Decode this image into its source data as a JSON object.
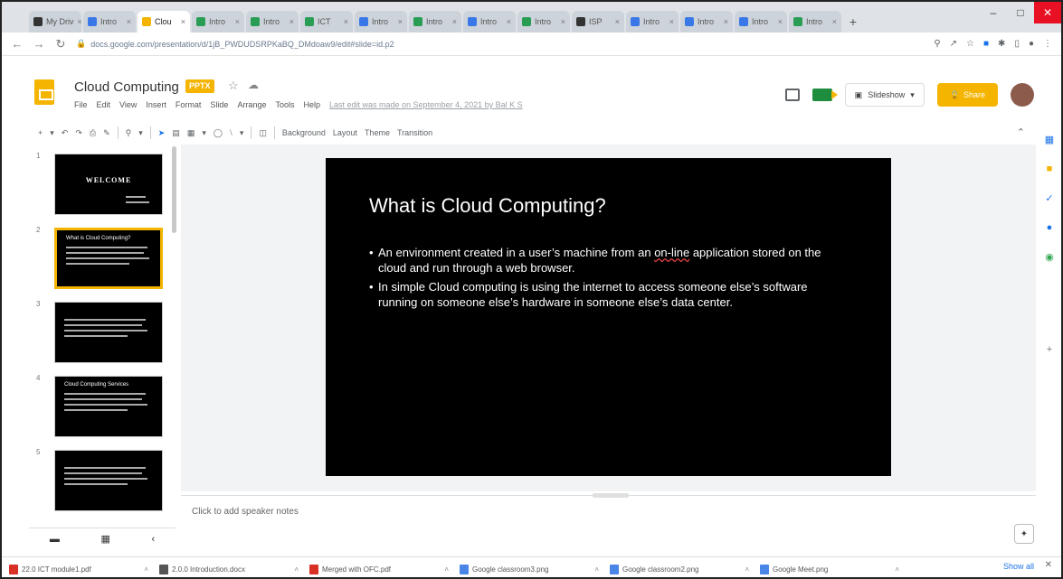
{
  "browser": {
    "tabs": [
      {
        "label": "My Driv",
        "icon": "drive-icon",
        "color": "dark",
        "active": false
      },
      {
        "label": "Intro",
        "icon": "slides-icon",
        "color": "blue",
        "active": false
      },
      {
        "label": "Clou",
        "icon": "slides-icon",
        "color": "yellow",
        "active": true
      },
      {
        "label": "Intro",
        "icon": "classroom-icon",
        "color": "",
        "active": false
      },
      {
        "label": "Intro",
        "icon": "classroom-icon",
        "color": "",
        "active": false
      },
      {
        "label": "ICT",
        "icon": "classroom-icon",
        "color": "",
        "active": false
      },
      {
        "label": "Intro",
        "icon": "google-icon",
        "color": "blue",
        "active": false
      },
      {
        "label": "Intro",
        "icon": "classroom-icon",
        "color": "",
        "active": false
      },
      {
        "label": "Intro",
        "icon": "classroom-icon",
        "color": "blue",
        "active": false
      },
      {
        "label": "Intro",
        "icon": "classroom-icon",
        "color": "",
        "active": false
      },
      {
        "label": "ISP",
        "icon": "n-icon",
        "color": "dark",
        "active": false
      },
      {
        "label": "Intro",
        "icon": "web-icon",
        "color": "blue",
        "active": false
      },
      {
        "label": "Intro",
        "icon": "web-icon",
        "color": "blue",
        "active": false
      },
      {
        "label": "Intro",
        "icon": "web-icon",
        "color": "blue",
        "active": false
      },
      {
        "label": "Intro",
        "icon": "classroom-icon",
        "color": "",
        "active": false
      }
    ],
    "new_tab": "+",
    "url": "docs.google.com/presentation/d/1jB_PWDUDSRPKaBQ_DMdoaw9/edit#slide=id.p2"
  },
  "doc": {
    "title": "Cloud Computing",
    "badge": "PPTX",
    "menu": [
      "File",
      "Edit",
      "View",
      "Insert",
      "Format",
      "Slide",
      "Arrange",
      "Tools",
      "Help"
    ],
    "last_edit": "Last edit was made on September 4, 2021 by Bal K S",
    "slideshow_label": "Slideshow",
    "share_label": "Share"
  },
  "toolbar": {
    "background": "Background",
    "layout": "Layout",
    "theme": "Theme",
    "transition": "Transition"
  },
  "filmstrip": {
    "slides": [
      {
        "num": "1",
        "title": "WELCOME"
      },
      {
        "num": "2",
        "title": "What is Cloud Computing?"
      },
      {
        "num": "3",
        "title": ""
      },
      {
        "num": "4",
        "title": "Cloud Computing Services"
      },
      {
        "num": "5",
        "title": ""
      }
    ]
  },
  "slide": {
    "title": "What  is Cloud Computing?",
    "bullets": [
      {
        "pre": "An environment created in a user’s machine from an ",
        "flag": "on-line",
        "post": " application stored on the cloud and run through a web browser."
      },
      {
        "pre": "In simple Cloud computing is using the internet to access someone else’s software running on someone else’s hardware in someone else’s data center.",
        "flag": "",
        "post": ""
      }
    ]
  },
  "notes": {
    "placeholder": "Click to add speaker notes"
  },
  "downloads": {
    "items": [
      {
        "name": "22.0 ICT module1.pdf",
        "type": "pdf"
      },
      {
        "name": "2.0.0 Introduction.docx",
        "type": "doc"
      },
      {
        "name": "Merged with OFC.pdf",
        "type": "pdf"
      },
      {
        "name": "Google classroom3.png",
        "type": "img"
      },
      {
        "name": "Google classroom2.png",
        "type": "img"
      },
      {
        "name": "Google Meet.png",
        "type": "img"
      }
    ],
    "show_all": "Show all"
  },
  "colors": {
    "accent": "#f4b400",
    "slide_bg": "#000000",
    "link": "#1a73e8"
  }
}
